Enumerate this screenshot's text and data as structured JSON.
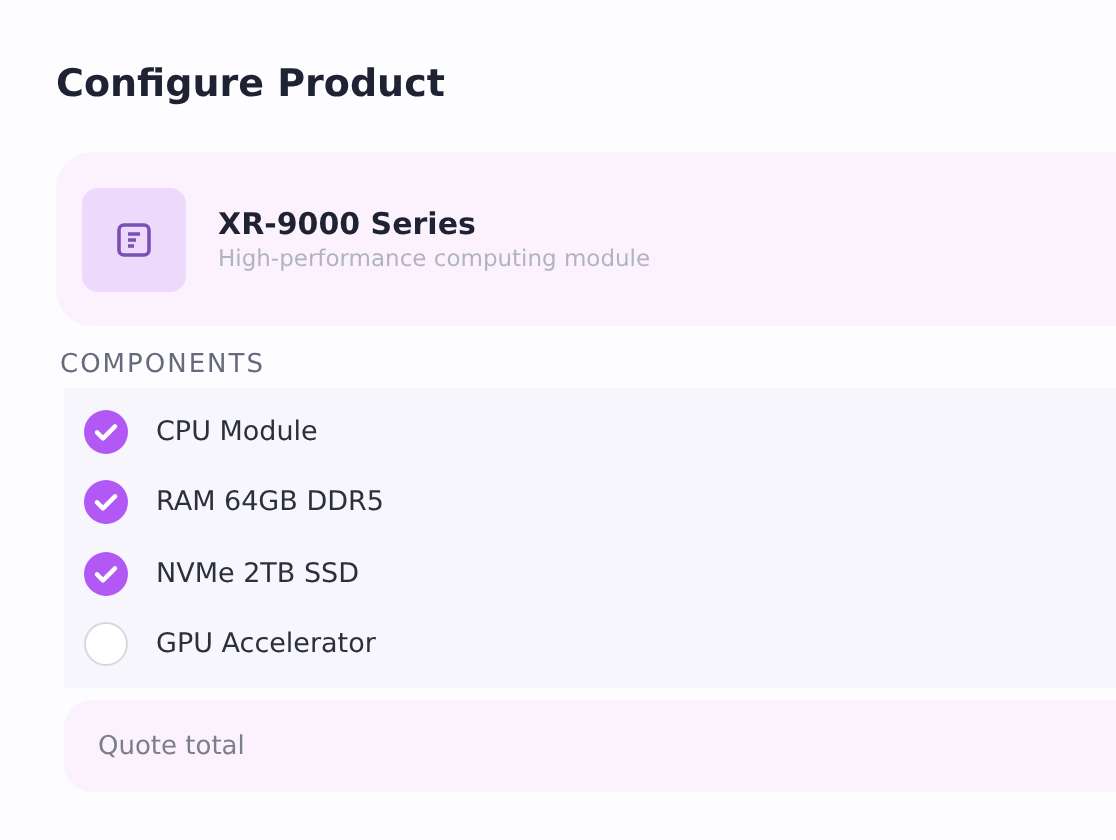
{
  "title": "Configure Product",
  "product": {
    "name": "XR-9000 Series",
    "description": "High-performance computing module"
  },
  "components_heading": "COMPONENTS",
  "components": [
    {
      "label": "CPU Module",
      "checked": true
    },
    {
      "label": "RAM 64GB DDR5",
      "checked": true
    },
    {
      "label": "NVMe 2TB SSD",
      "checked": true
    },
    {
      "label": "GPU Accelerator",
      "checked": false
    }
  ],
  "quote": {
    "label": "Quote total"
  }
}
